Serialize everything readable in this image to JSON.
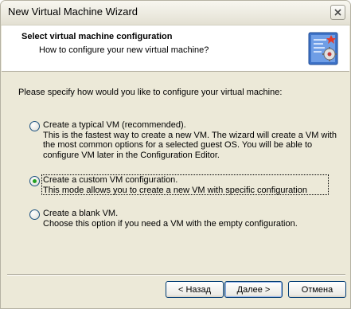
{
  "window": {
    "title": "New Virtual Machine Wizard"
  },
  "header": {
    "title": "Select virtual machine configuration",
    "subtitle": "How to configure your new virtual machine?",
    "icon": "wizard-gear-icon"
  },
  "content": {
    "instruction": "Please specify how would you like to configure your virtual machine:",
    "options": [
      {
        "label": "Create a typical VM (recommended).",
        "description_lines": [
          "This is the fastest way to create a new VM. The wizard will create a VM with",
          "the most common options for a selected guest OS. You will be able to",
          "configure VM later in the Configuration Editor."
        ],
        "selected": false
      },
      {
        "label": "Create a custom VM configuration.",
        "description_lines": [
          "This mode allows you to create a new VM with specific configuration"
        ],
        "selected": true
      },
      {
        "label": "Create a blank VM.",
        "description_lines": [
          "Choose this option if you need a VM with the empty configuration."
        ],
        "selected": false
      }
    ]
  },
  "buttons": {
    "back": "< Назад",
    "next": "Далее >",
    "cancel": "Отмена"
  },
  "colors": {
    "dialog_bg": "#ece9d8",
    "radio_dot": "#21a121",
    "button_border": "#003c74"
  }
}
